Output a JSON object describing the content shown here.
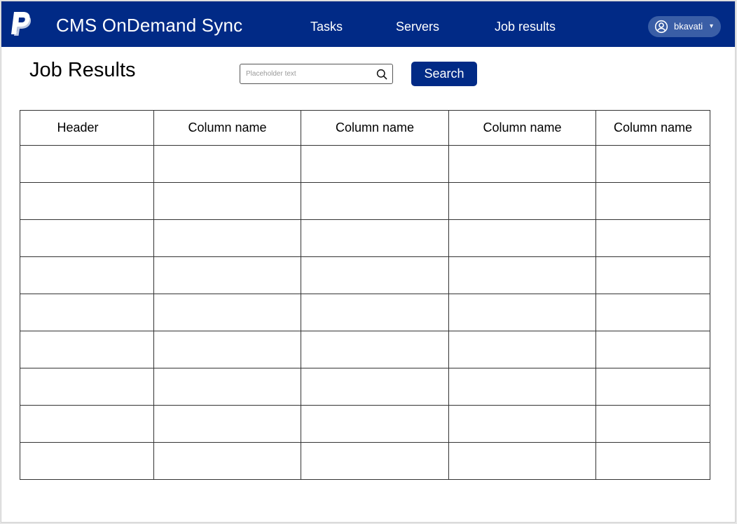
{
  "header": {
    "app_title": "CMS OnDemand Sync",
    "logo_icon": "paypal-logo-icon",
    "brand_color": "#012a86",
    "nav": [
      {
        "label": "Tasks"
      },
      {
        "label": "Servers"
      },
      {
        "label": "Job results"
      }
    ],
    "user": {
      "name": "bkavati",
      "icon": "user-circle-icon",
      "caret": "▾"
    }
  },
  "main": {
    "page_title": "Job Results",
    "search": {
      "placeholder": "Placeholder text",
      "value": "",
      "button_label": "Search",
      "icon": "search-icon"
    },
    "table": {
      "columns": [
        "Header",
        "Column name",
        "Column name",
        "Column name",
        "Column name"
      ],
      "rows": [
        [
          "",
          "",
          "",
          "",
          ""
        ],
        [
          "",
          "",
          "",
          "",
          ""
        ],
        [
          "",
          "",
          "",
          "",
          ""
        ],
        [
          "",
          "",
          "",
          "",
          ""
        ],
        [
          "",
          "",
          "",
          "",
          ""
        ],
        [
          "",
          "",
          "",
          "",
          ""
        ],
        [
          "",
          "",
          "",
          "",
          ""
        ],
        [
          "",
          "",
          "",
          "",
          ""
        ],
        [
          "",
          "",
          "",
          "",
          ""
        ]
      ]
    }
  }
}
